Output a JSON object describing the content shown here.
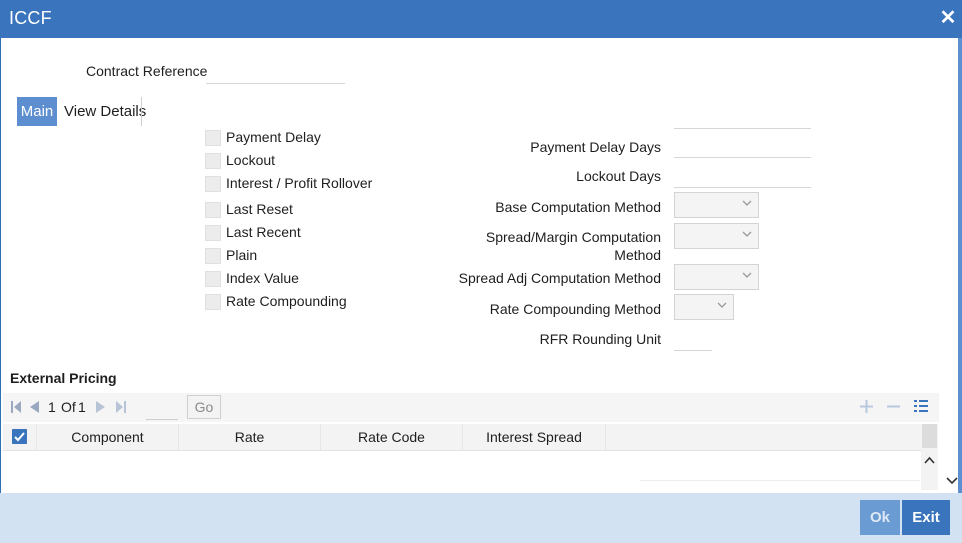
{
  "window": {
    "title": "ICCF",
    "close_symbol": "✕"
  },
  "contract_reference": {
    "label": "Contract Reference",
    "value": ""
  },
  "tabs": [
    {
      "label": "Main",
      "active": true
    },
    {
      "label": "View Details",
      "active": false
    }
  ],
  "checkboxes": [
    {
      "label": "Payment Delay",
      "checked": false
    },
    {
      "label": "Lockout",
      "checked": false
    },
    {
      "label": "Interest / Profit Rollover",
      "checked": false
    },
    {
      "label": "Last Reset",
      "checked": false
    },
    {
      "label": "Last Recent",
      "checked": false
    },
    {
      "label": "Plain",
      "checked": false
    },
    {
      "label": "Index Value",
      "checked": false
    },
    {
      "label": "Rate Compounding",
      "checked": false
    }
  ],
  "fields": {
    "payment_delay_days": {
      "label": "Payment Delay Days",
      "value": ""
    },
    "lockout_days": {
      "label": "Lockout Days",
      "value": ""
    },
    "base_computation_method": {
      "label": "Base Computation Method",
      "value": ""
    },
    "spread_margin_computation_method": {
      "label_line1": "Spread/Margin Computation",
      "label_line2": "Method",
      "value": ""
    },
    "spread_adj_computation_method": {
      "label": "Spread Adj Computation Method",
      "value": ""
    },
    "rate_compounding_method": {
      "label": "Rate Compounding Method",
      "value": ""
    },
    "rfr_rounding_unit": {
      "label": "RFR Rounding Unit",
      "value": ""
    }
  },
  "external_pricing": {
    "title": "External Pricing",
    "pager": {
      "current": "1",
      "of_label": "Of",
      "total": "1",
      "go_label": "Go"
    },
    "columns": [
      "Component",
      "Rate",
      "Rate Code",
      "Interest Spread"
    ],
    "rows": []
  },
  "footer": {
    "ok_label": "Ok",
    "exit_label": "Exit"
  },
  "colors": {
    "titlebar": "#3a74bd",
    "active_tab": "#5d8fd0",
    "footer": "#d2e2f3",
    "exit_button": "#3a74bd",
    "ok_button": "#6a9bd3"
  }
}
